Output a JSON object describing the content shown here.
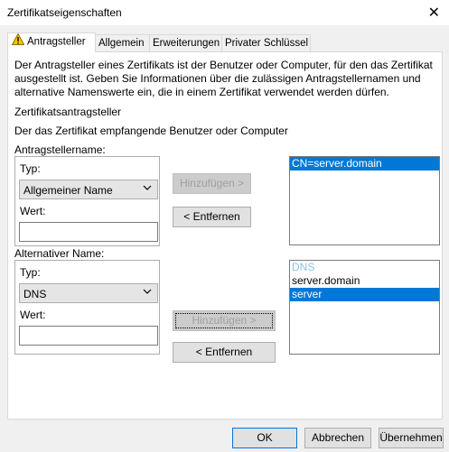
{
  "window": {
    "title": "Zertifikatseigenschaften",
    "close": "✕"
  },
  "tabs": [
    {
      "label": "Antragsteller",
      "active": true
    },
    {
      "label": "Allgemein"
    },
    {
      "label": "Erweiterungen"
    },
    {
      "label": "Privater Schlüssel"
    }
  ],
  "intro": {
    "line1": "Der Antragsteller eines Zertifikats ist der Benutzer oder Computer, für den das Zertifikat",
    "line2": "ausgestellt ist. Geben Sie Informationen über die zulässigen Antragstellernamen und",
    "line3": "alternative Namenswerte ein, die in einem Zertifikat verwendet werden dürfen."
  },
  "section": {
    "title": "Zertifikatsantragsteller",
    "desc": "Der das Zertifikat empfangende Benutzer oder Computer"
  },
  "subject_name": {
    "label": "Antragstellername:",
    "type_label": "Typ:",
    "type_value": "Allgemeiner Name",
    "value_label": "Wert:",
    "value": "",
    "add": "Hinzufügen >",
    "remove": "< Entfernen",
    "list": [
      "CN=server.domain"
    ]
  },
  "alt_name": {
    "label": "Alternativer Name:",
    "type_label": "Typ:",
    "type_value": "DNS",
    "value_label": "Wert:",
    "value": "",
    "add": "Hinzufügen >",
    "remove": "< Entfernen",
    "list_header": "DNS",
    "list": [
      "server.domain",
      "server"
    ]
  },
  "footer": {
    "ok": "OK",
    "cancel": "Abbrechen",
    "apply": "Übernehmen"
  },
  "colors": {
    "accent": "#0078d7",
    "warning": "#f7c600"
  }
}
